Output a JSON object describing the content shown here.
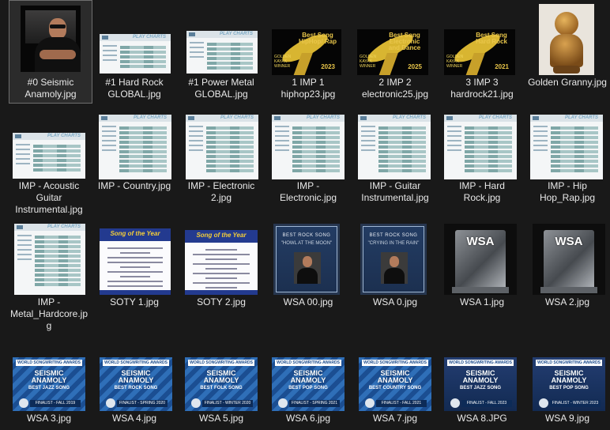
{
  "files": [
    {
      "name": "#0 Seismic Anamoly.jpg",
      "kind": "photo"
    },
    {
      "name": "#1 Hard Rock GLOBAL.jpg",
      "kind": "screenshot"
    },
    {
      "name": "#1 Power Metal GLOBAL.jpg",
      "kind": "screenshot"
    },
    {
      "name": "1 IMP 1 hiphop23.jpg",
      "kind": "award",
      "title": "Best Song HipHop/ Rap",
      "left": "GOLDEN KAYAK WINNER",
      "year": "2023"
    },
    {
      "name": "2 IMP 2 electronic25.jpg",
      "kind": "award",
      "title": "Best Song Electronic and Dance",
      "left": "GOLDEN KAYAK WINNER",
      "year": "2025"
    },
    {
      "name": "3 IMP 3 hardrock21.jpg",
      "kind": "award",
      "title": "Best Song Hard Rock",
      "left": "GOLDEN KAYAK WINNER",
      "year": "2021"
    },
    {
      "name": "Golden Granny.jpg",
      "kind": "figurine"
    },
    {
      "name": "IMP - Acoustic Guitar Instrumental.jpg",
      "kind": "screenshot"
    },
    {
      "name": "IMP - Country.jpg",
      "kind": "screenshot"
    },
    {
      "name": "IMP - Electronic 2.jpg",
      "kind": "screenshot"
    },
    {
      "name": "IMP - Electronic.jpg",
      "kind": "screenshot"
    },
    {
      "name": "IMP - Guitar Instrumental.jpg",
      "kind": "screenshot"
    },
    {
      "name": "IMP - Hard Rock.jpg",
      "kind": "screenshot"
    },
    {
      "name": "IMP - Hip Hop_Rap.jpg",
      "kind": "screenshot"
    },
    {
      "name": "IMP - Metal_Hardcore.jpg",
      "kind": "screenshot"
    },
    {
      "name": "SOTY 1.jpg",
      "kind": "doc",
      "banner": "Song of the Year"
    },
    {
      "name": "SOTY 2.jpg",
      "kind": "doc",
      "banner": "Song of the Year"
    },
    {
      "name": "WSA 00.jpg",
      "kind": "plaque",
      "t1": "BEST ROCK SONG",
      "t2": "\"HOWL AT THE MOON\""
    },
    {
      "name": "WSA 0.jpg",
      "kind": "plaque",
      "t1": "BEST ROCK SONG",
      "t2": "\"CRYING IN THE RAIN\""
    },
    {
      "name": "WSA 1.jpg",
      "kind": "glass",
      "logo": "WSA"
    },
    {
      "name": "WSA 2.jpg",
      "kind": "glass",
      "logo": "WSA"
    },
    {
      "name": "WSA 3.jpg",
      "kind": "poster",
      "top": "WORLD SONGWRITING AWARDS",
      "artist": "SEISMIC ANAMOLY",
      "category": "BEST JAZZ SONG",
      "finalist": "FINALIST - FALL 2019"
    },
    {
      "name": "WSA 4.jpg",
      "kind": "poster",
      "top": "WORLD SONGWRITING AWARDS",
      "artist": "SEISMIC ANAMOLY",
      "category": "BEST ROCK SONG",
      "finalist": "FINALIST - SPRING 2020"
    },
    {
      "name": "WSA 5.jpg",
      "kind": "poster",
      "top": "WORLD SONGWRITING AWARDS",
      "artist": "SEISMIC ANAMOLY",
      "category": "BEST FOLK SONG",
      "finalist": "FINALIST - WINTER 2020"
    },
    {
      "name": "WSA 6.jpg",
      "kind": "poster",
      "top": "WORLD SONGWRITING AWARDS",
      "artist": "SEISMIC ANAMOLY",
      "category": "BEST POP SONG",
      "finalist": "FINALIST - SPRING 2021"
    },
    {
      "name": "WSA 7.jpg",
      "kind": "poster",
      "top": "WORLD SONGWRITING AWARDS",
      "artist": "SEISMIC ANAMOLY",
      "category": "BEST COUNTRY SONG",
      "finalist": "FINALIST - FALL 2021"
    },
    {
      "name": "WSA 8.JPG",
      "kind": "poster-dark",
      "top": "WORLD SONGWRITING AWARDS",
      "artist": "SEISMIC ANAMOLY",
      "category": "BEST JAZZ SONG",
      "finalist": "FINALIST - FALL 2023"
    },
    {
      "name": "WSA 9.jpg",
      "kind": "poster-dark",
      "top": "WORLD SONGWRITING AWARDS",
      "artist": "SEISMIC ANAMOLY",
      "category": "BEST POP SONG",
      "finalist": "FINALIST - WINTER 2023"
    }
  ],
  "selected_index": 0,
  "colors": {
    "background": "#191919",
    "text": "#e8e8e8",
    "selection_border": "#6e6e6e"
  }
}
